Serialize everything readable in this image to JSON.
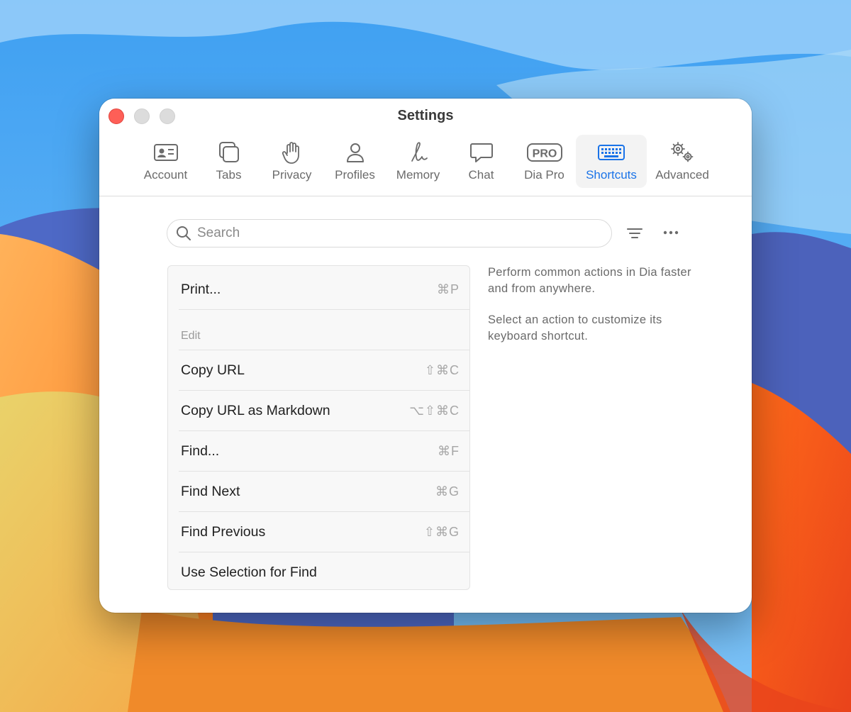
{
  "window": {
    "title": "Settings"
  },
  "tabs": [
    {
      "label": "Account",
      "icon": "account-card-icon"
    },
    {
      "label": "Tabs",
      "icon": "tabs-icon"
    },
    {
      "label": "Privacy",
      "icon": "hand-icon"
    },
    {
      "label": "Profiles",
      "icon": "person-icon"
    },
    {
      "label": "Memory",
      "icon": "memory-icon"
    },
    {
      "label": "Chat",
      "icon": "chat-bubble-icon"
    },
    {
      "label": "Dia Pro",
      "icon": "pro-badge-icon"
    },
    {
      "label": "Shortcuts",
      "icon": "keyboard-icon",
      "active": true
    },
    {
      "label": "Advanced",
      "icon": "gears-icon"
    }
  ],
  "pro_badge_text": "PRO",
  "search": {
    "placeholder": "Search"
  },
  "shortcut_list": {
    "items": [
      {
        "name": "Print...",
        "shortcut": "⌘P"
      },
      {
        "name": "Copy URL",
        "shortcut": "⇧⌘C"
      },
      {
        "name": "Copy URL as Markdown",
        "shortcut": "⌥⇧⌘C"
      },
      {
        "name": "Find...",
        "shortcut": "⌘F"
      },
      {
        "name": "Find Next",
        "shortcut": "⌘G"
      },
      {
        "name": "Find Previous",
        "shortcut": "⇧⌘G"
      },
      {
        "name": "Use Selection for Find",
        "shortcut": ""
      }
    ],
    "section_edit": "Edit"
  },
  "help": {
    "line1": "Perform common actions in Dia faster and from anywhere.",
    "line2": "Select an action to customize its keyboard shortcut."
  },
  "colors": {
    "accent": "#1a73e8",
    "close": "#fe5f57",
    "inactive_light": "#dcdcdc"
  }
}
